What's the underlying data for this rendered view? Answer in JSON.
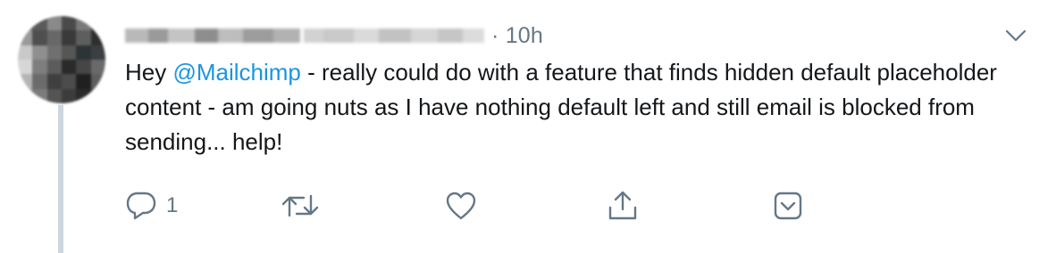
{
  "tweet": {
    "author_display_name": "",
    "author_handle": "",
    "separator": "·",
    "timestamp": "10h",
    "text_parts": {
      "before": "Hey ",
      "mention": "@Mailchimp",
      "after": " - really could do with a feature that finds hidden default placeholder content - am going nuts as I have nothing default left and still email is blocked from sending... help!"
    }
  },
  "actions": {
    "reply_count": "1",
    "retweet_count": "",
    "like_count": ""
  },
  "icons": {
    "more": "chevron-down-icon",
    "reply": "reply-icon",
    "retweet": "retweet-icon",
    "like": "heart-icon",
    "share": "share-icon",
    "dm": "dm-icon"
  },
  "colors": {
    "mention": "#1b95e0",
    "secondary_text": "#657786",
    "primary_text": "#14171a",
    "thread_line": "#ccd6dd"
  }
}
